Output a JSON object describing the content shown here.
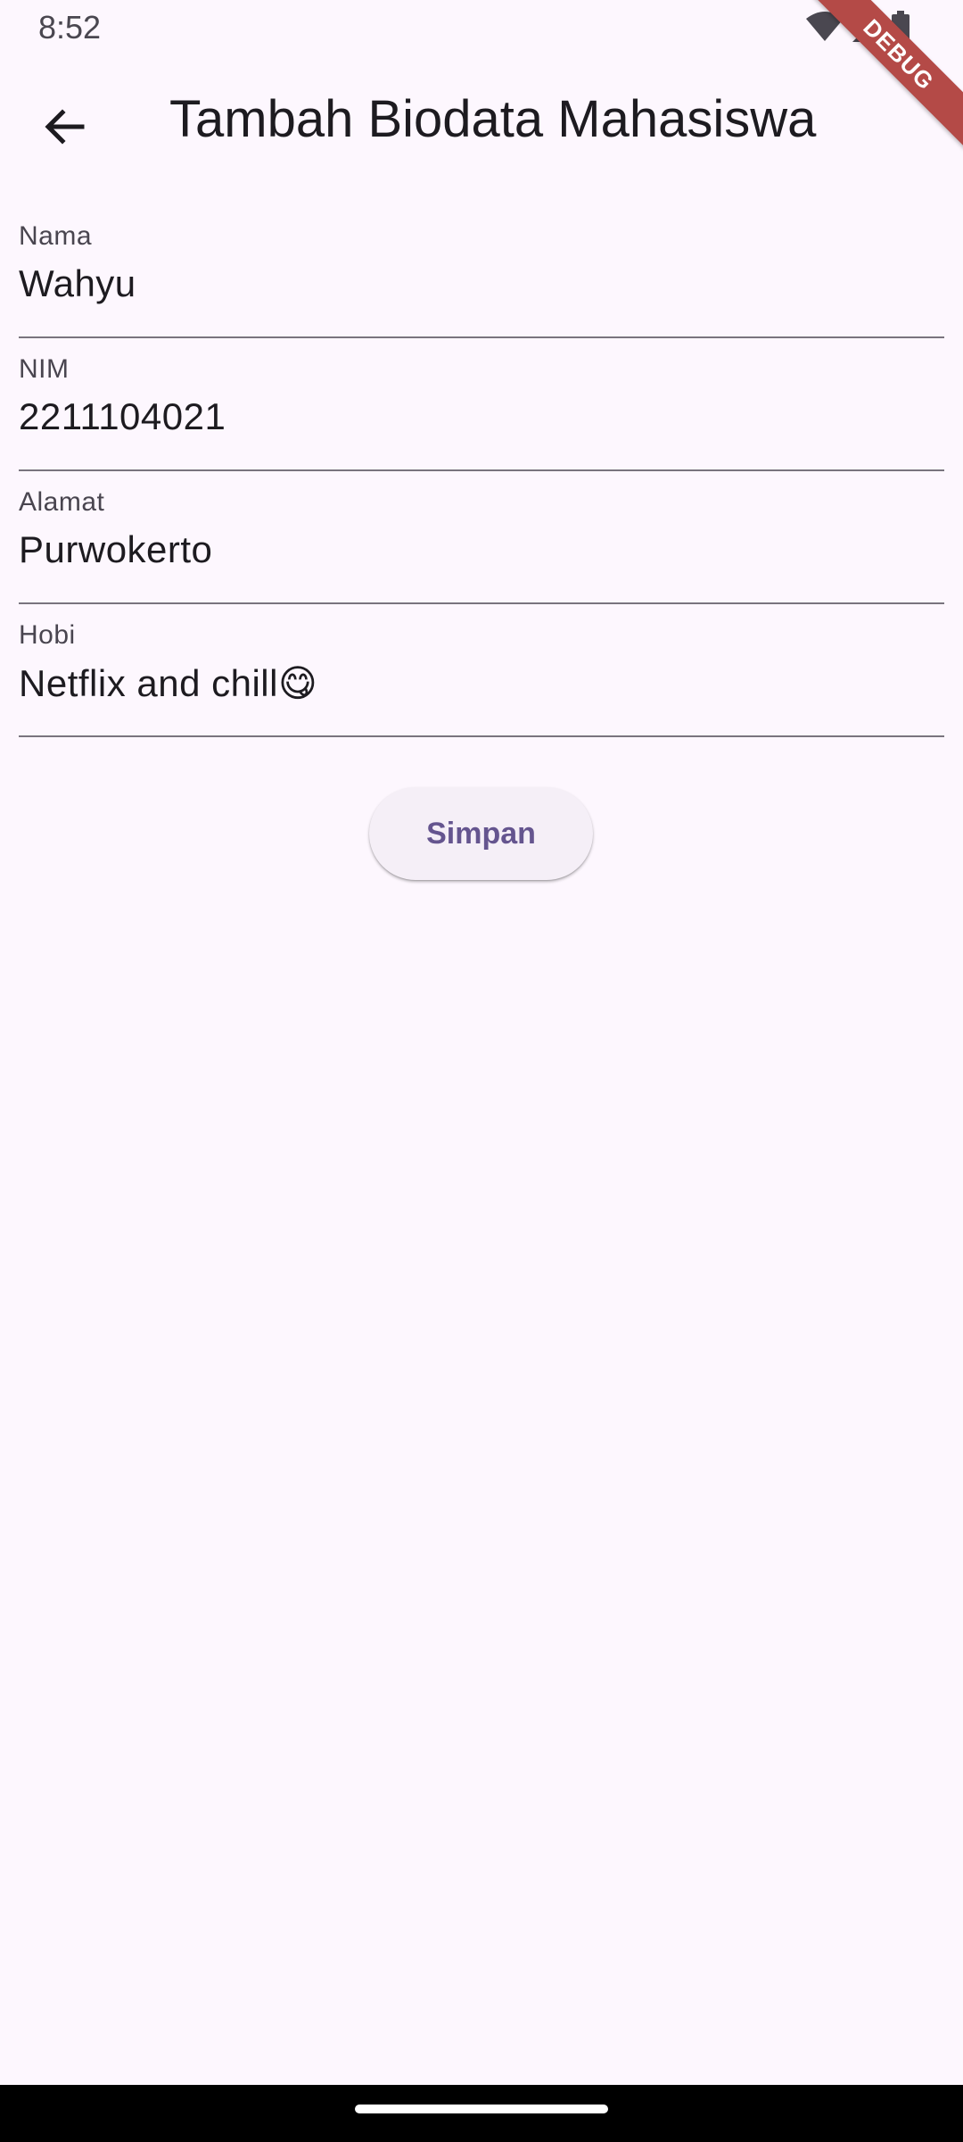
{
  "status_bar": {
    "time": "8:52",
    "icons": [
      "wifi-icon",
      "cellular-signal-icon",
      "battery-icon"
    ]
  },
  "debug_banner": {
    "label": "DEBUG",
    "color": "#b44a47"
  },
  "app_bar": {
    "back_icon": "arrow-back-icon",
    "title": "Tambah Biodata Mahasiswa"
  },
  "form": {
    "fields": [
      {
        "label": "Nama",
        "value": "Wahyu"
      },
      {
        "label": "NIM",
        "value": "2211104021"
      },
      {
        "label": "Alamat",
        "value": "Purwokerto"
      },
      {
        "label": "Hobi",
        "value": "Netflix and chill😋"
      }
    ],
    "submit_label": "Simpan"
  },
  "theme": {
    "background": "#fdf7fe",
    "primary": "#65558f",
    "underline": "#79747e"
  }
}
